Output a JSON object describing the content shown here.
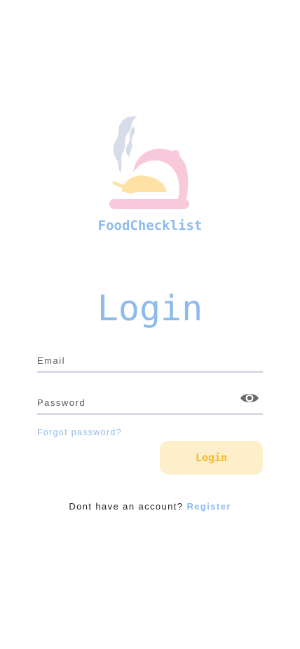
{
  "app": {
    "name": "FoodChecklist",
    "logo_icon": "food-cloche-icon"
  },
  "login": {
    "title": "Login",
    "email_placeholder": "Email",
    "email_value": "",
    "password_placeholder": "Password",
    "password_value": "",
    "password_toggle_icon": "eye-icon",
    "forgot_password": "Forgot password?",
    "login_button": "Login",
    "no_account_text": "Dont have an account?",
    "register_link": "Register"
  },
  "colors": {
    "accent_blue": "#8dbbec",
    "button_bg": "#fdefc9",
    "button_text": "#f5bb2a",
    "logo_pink": "#f8c9da",
    "logo_yellow": "#fde1a5",
    "steam_gray": "#d7dde8"
  }
}
